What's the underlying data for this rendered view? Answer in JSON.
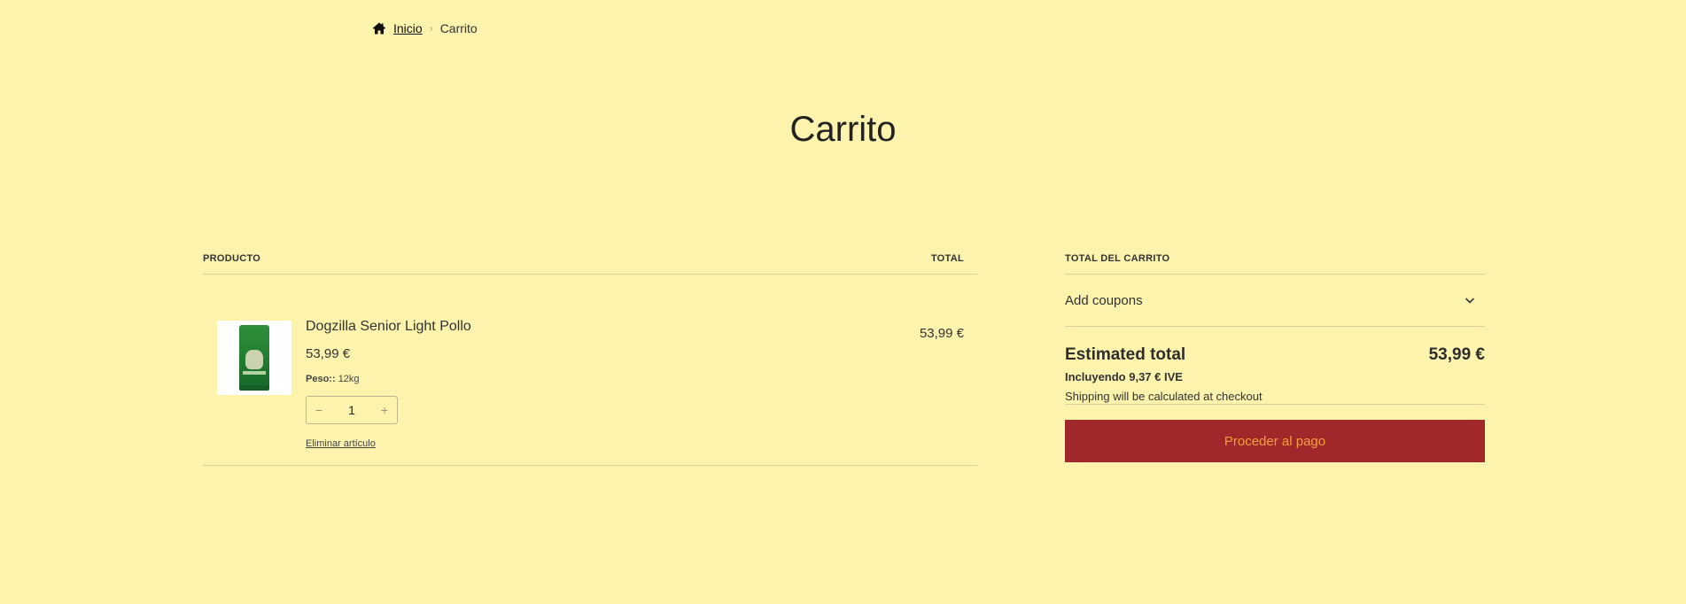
{
  "breadcrumb": {
    "home_label": "Inicio",
    "current": "Carrito",
    "separator": "›"
  },
  "page": {
    "title": "Carrito"
  },
  "cart": {
    "columns": {
      "product": "PRODUCTO",
      "total": "TOTAL"
    },
    "items": [
      {
        "name": "Dogzilla Senior Light Pollo",
        "price": "53,99 €",
        "meta_label": "Peso::",
        "meta_value": "12kg",
        "quantity": "1",
        "decrement": "−",
        "increment": "+",
        "remove_label": "Eliminar artículo",
        "line_total": "53,99 €",
        "image_icon": "product-bag-image"
      }
    ]
  },
  "totals": {
    "heading": "TOTAL DEL CARRITO",
    "coupons_label": "Add coupons",
    "estimated_label": "Estimated total",
    "estimated_value": "53,99 €",
    "tax_line": "Incluyendo 9,37 € IVE",
    "shipping_line": "Shipping will be calculated at checkout",
    "checkout_label": "Proceder al pago"
  },
  "colors": {
    "background": "#fdf3ad",
    "checkout_button_bg": "#a0282b",
    "checkout_button_text": "#f0a13a"
  }
}
